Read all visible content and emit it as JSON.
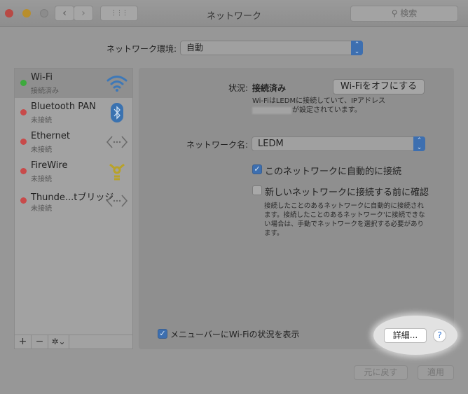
{
  "window": {
    "title": "ネットワーク",
    "search_placeholder": "検索",
    "nav_back": "‹",
    "nav_forward": "›",
    "grid_icon": "⋮⋮⋮"
  },
  "location": {
    "label": "ネットワーク環境:",
    "value": "自動"
  },
  "services": [
    {
      "name": "Wi-Fi",
      "status": "接続済み",
      "status_color": "#3daa3d",
      "icon": "wifi-icon",
      "selected": true
    },
    {
      "name": "Bluetooth PAN",
      "status": "未接続",
      "status_color": "#c84a4a",
      "icon": "bluetooth-icon"
    },
    {
      "name": "Ethernet",
      "status": "未接続",
      "status_color": "#c84a4a",
      "icon": "ethernet-icon"
    },
    {
      "name": "FireWire",
      "status": "未接続",
      "status_color": "#c84a4a",
      "icon": "firewire-icon"
    },
    {
      "name": "Thunde...tブリッジ",
      "status": "未接続",
      "status_color": "#c84a4a",
      "icon": "thunderbolt-bridge-icon"
    }
  ],
  "sidebar_toolbar": {
    "add": "+",
    "remove": "−",
    "gear": "✲⌄"
  },
  "detail": {
    "status_label": "状況:",
    "status_value": "接続済み",
    "turn_off_button": "Wi-Fiをオフにする",
    "status_desc_1": "Wi-FiはLEDMに接続していて、IPアドレス",
    "status_desc_2": "が設定されています。",
    "network_name_label": "ネットワーク名:",
    "network_name_value": "LEDM",
    "auto_join_label": "このネットワークに自動的に接続",
    "auto_join_checked": true,
    "ask_join_label": "新しいネットワークに接続する前に確認",
    "ask_join_checked": false,
    "ask_join_desc": "接続したことのあるネットワークに自動的に接続されます。接続したことのあるネットワーク'に接続できない場合は、手動でネットワークを選択する必要があります。",
    "menubar_label": "メニューバーにWi-Fiの状況を表示",
    "menubar_checked": true,
    "advanced_button": "詳細...",
    "help_button": "?"
  },
  "footer": {
    "revert_button": "元に戻す",
    "apply_button": "適用"
  }
}
